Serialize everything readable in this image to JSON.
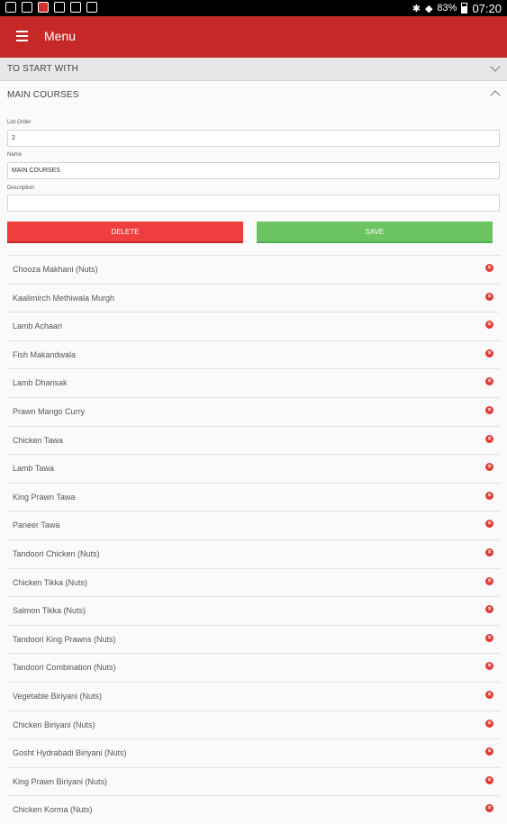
{
  "status_bar": {
    "battery": "83%",
    "time": "07:20",
    "icons": [
      "whatsapp-icon",
      "image-icon",
      "app-icon",
      "shop-icon",
      "bag-icon",
      "briefcase-icon",
      "bluetooth-icon",
      "wifi-icon",
      "battery-icon"
    ]
  },
  "appbar": {
    "title": "Menu",
    "menu_icon": "hamburger-icon",
    "color": "#c62828"
  },
  "sections": {
    "collapsed_title": "TO START WITH",
    "open_title": "MAIN COURSES"
  },
  "form": {
    "list_order_label": "List Order",
    "list_order_value": "2",
    "name_label": "Name",
    "name_value": "MAIN COURSES",
    "description_label": "Description",
    "description_value": ""
  },
  "buttons": {
    "delete_label": "DELETE",
    "save_label": "SAVE",
    "delete_color": "#ef3e3e",
    "save_color": "#6cc462"
  },
  "items": [
    "Chooza Makhani (Nuts)",
    "Kaalimirch Methiwala Murgh",
    "Lamb Achaari",
    "Fish Makandwala",
    "Lamb Dhansak",
    "Prawn Mango Curry",
    "Chicken Tawa",
    "Lamb Tawa",
    "King Prawn Tawa",
    "Paneer Tawa",
    "Tandoori Chicken (Nuts)",
    "Chicken Tikka (Nuts)",
    "Salmon Tikka (Nuts)",
    "Tandoori King Prawns (Nuts)",
    "Tandoori Combination (Nuts)",
    "Vegetable Biriyani (Nuts)",
    "Chicken Biriyani (Nuts)",
    "Gosht Hydrabadi Biriyani (Nuts)",
    "King Prawn Biriyani (Nuts)",
    "Chicken Korma (Nuts)"
  ]
}
